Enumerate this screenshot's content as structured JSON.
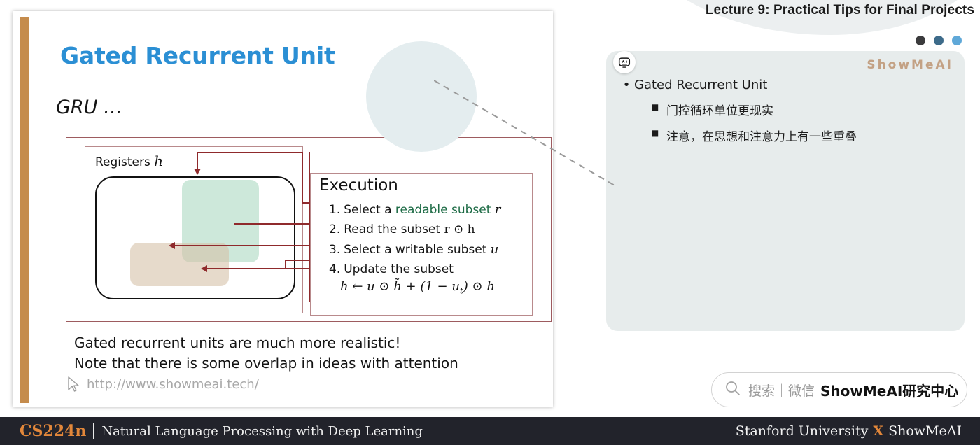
{
  "header": {
    "lecture_title": "Lecture 9: Practical Tips for Final Projects",
    "dots": [
      {
        "name": "dot-dark",
        "color": "#3b3b3d"
      },
      {
        "name": "dot-steel",
        "color": "#3d6b8a"
      },
      {
        "name": "dot-light",
        "color": "#5fa8d8"
      }
    ]
  },
  "slide": {
    "title": "Gated Recurrent Unit",
    "subtitle": "GRU …",
    "accent_color": "#c58c4d",
    "title_color": "#2b8fd4",
    "diagram": {
      "registers_label": "Registers",
      "registers_symbol": "h",
      "execution_title": "Execution",
      "steps": [
        {
          "num": "1.",
          "pre": "Select a ",
          "highlight": "readable subset",
          "post": "",
          "symbol": "r"
        },
        {
          "num": "2.",
          "pre": "Read the subset ",
          "highlight": "",
          "post": "",
          "symbol": "r ⊙ h"
        },
        {
          "num": "3.",
          "pre": "Select a writable subset ",
          "highlight": "",
          "post": "",
          "symbol": "u"
        },
        {
          "num": "4.",
          "pre": "Update the subset",
          "highlight": "",
          "post": "",
          "symbol": ""
        }
      ],
      "formula": "h ← u ⊙ h̃ + (1 − u",
      "formula_sub": "t",
      "formula_end": ") ⊙ h",
      "highlight_color": "#1d6b45",
      "line_color": "#8f2a2c",
      "green_block_color": "#afdac4",
      "tan_block_color": "#d5c1a9"
    },
    "notes": [
      "Gated recurrent units are much more realistic!",
      "Note that there is some overlap in ideas with attention"
    ],
    "url": "http://www.showmeai.tech/"
  },
  "panel": {
    "watermark": "ShowMeAI",
    "bot_icon": "robot-face-icon",
    "bullet_main": "Gated Recurrent Unit",
    "bullet_sub": [
      "门控循环单位更现实",
      "注意，在思想和注意力上有一些重叠"
    ],
    "bullet_glyph": "•",
    "square_glyph": "■",
    "bg_color": "#e7ecec",
    "watermark_color": "#c3a184"
  },
  "search": {
    "icon": "search-icon",
    "placeholder": "搜索｜微信",
    "brand": "ShowMeAI研究中心"
  },
  "footer": {
    "course_code": "CS224n",
    "course_name": "Natural Language Processing with Deep Learning",
    "right_left": "Stanford University",
    "right_x": "X",
    "right_right": "ShowMeAI",
    "bg_color": "#22232b",
    "accent_color": "#e2873a"
  }
}
